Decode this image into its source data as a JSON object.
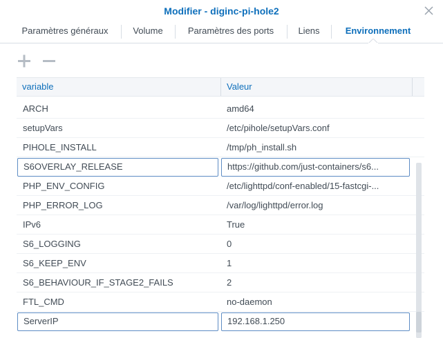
{
  "window": {
    "title": "Modifier - diginc-pi-hole2",
    "close_icon": "close-icon"
  },
  "tabs": [
    {
      "label": "Paramètres généraux"
    },
    {
      "label": "Volume"
    },
    {
      "label": "Paramètres des ports"
    },
    {
      "label": "Liens"
    },
    {
      "label": "Environnement",
      "active": true
    }
  ],
  "toolbar": {
    "add_icon": "plus-icon",
    "remove_icon": "minus-icon"
  },
  "grid": {
    "columns": [
      "variable",
      "Valeur"
    ],
    "rows": [
      {
        "variable": "ARCH",
        "value": "amd64"
      },
      {
        "variable": "setupVars",
        "value": "/etc/pihole/setupVars.conf"
      },
      {
        "variable": "PIHOLE_INSTALL",
        "value": "/tmp/ph_install.sh"
      },
      {
        "variable": "S6OVERLAY_RELEASE",
        "value": "https://github.com/just-containers/s6...",
        "editing": true
      },
      {
        "variable": "PHP_ENV_CONFIG",
        "value": "/etc/lighttpd/conf-enabled/15-fastcgi-..."
      },
      {
        "variable": "PHP_ERROR_LOG",
        "value": "/var/log/lighttpd/error.log"
      },
      {
        "variable": "IPv6",
        "value": "True"
      },
      {
        "variable": "S6_LOGGING",
        "value": "0"
      },
      {
        "variable": "S6_KEEP_ENV",
        "value": "1"
      },
      {
        "variable": "S6_BEHAVIOUR_IF_STAGE2_FAILS",
        "value": "2"
      },
      {
        "variable": "FTL_CMD",
        "value": "no-daemon"
      },
      {
        "variable": "ServerIP",
        "value": "192.168.1.250",
        "editing": true
      }
    ]
  },
  "colors": {
    "accent": "#0e6fbb",
    "text": "#414b55",
    "border": "#d7dde4",
    "edit_border": "#5d8cc4"
  }
}
